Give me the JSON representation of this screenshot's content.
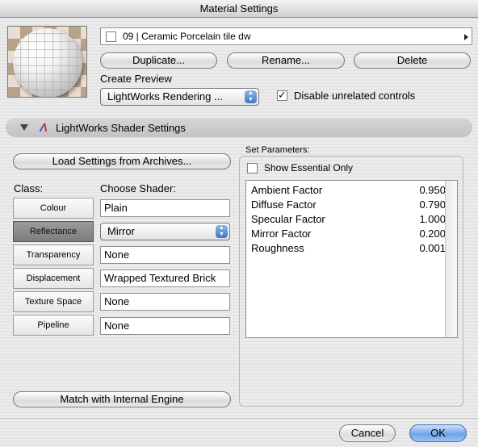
{
  "window": {
    "title": "Material Settings"
  },
  "header": {
    "material_select": {
      "value": "09 | Ceramic Porcelain tile dw"
    },
    "buttons": {
      "duplicate": "Duplicate...",
      "rename": "Rename...",
      "delete": "Delete"
    },
    "create_preview": {
      "label": "Create Preview",
      "value": "LightWorks Rendering ..."
    },
    "disable_unrelated": {
      "label": "Disable unrelated controls",
      "checked": true
    }
  },
  "section": {
    "title": "LightWorks Shader Settings",
    "logo_icon": "lightworks-logo-icon"
  },
  "left_panel": {
    "load_button": "Load Settings from Archives...",
    "class_header": "Class:",
    "choose_shader_header": "Choose Shader:",
    "rows": [
      {
        "class": "Colour",
        "shader": "Plain",
        "active": false,
        "popup": false
      },
      {
        "class": "Reflectance",
        "shader": "Mirror",
        "active": true,
        "popup": true
      },
      {
        "class": "Transparency",
        "shader": "None",
        "active": false,
        "popup": false
      },
      {
        "class": "Displacement",
        "shader": "Wrapped Textured Brick",
        "active": false,
        "popup": false
      },
      {
        "class": "Texture Space",
        "shader": "None",
        "active": false,
        "popup": false
      },
      {
        "class": "Pipeline",
        "shader": "None",
        "active": false,
        "popup": false
      }
    ],
    "match_button": "Match with Internal Engine"
  },
  "right_panel": {
    "set_parameters_label": "Set Parameters:",
    "show_essential": {
      "label": "Show Essential Only",
      "checked": false
    },
    "parameters": [
      {
        "name": "Ambient Factor",
        "value": "0.950"
      },
      {
        "name": "Diffuse Factor",
        "value": "0.790"
      },
      {
        "name": "Specular Factor",
        "value": "1.000"
      },
      {
        "name": "Mirror Factor",
        "value": "0.200"
      },
      {
        "name": "Roughness",
        "value": "0.001"
      }
    ]
  },
  "footer": {
    "cancel": "Cancel",
    "ok": "OK"
  },
  "colors": {
    "accent": "#6fa3ea",
    "active_class": "#8a8a8a"
  }
}
